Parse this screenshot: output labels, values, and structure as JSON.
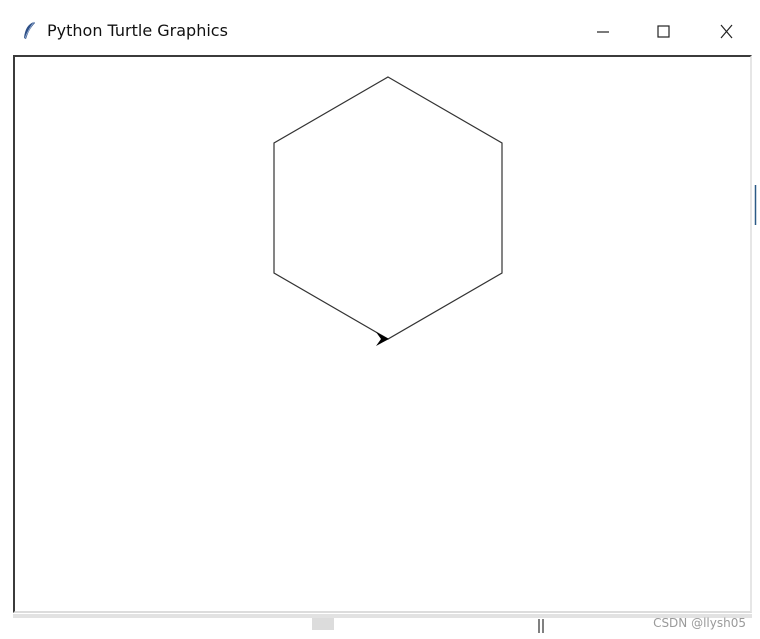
{
  "window": {
    "title": "Python Turtle Graphics",
    "app_icon": "tk-feather-icon",
    "controls": {
      "minimize": "minimize-icon",
      "maximize": "maximize-icon",
      "close": "close-icon"
    }
  },
  "canvas": {
    "background": "#ffffff",
    "drawing": {
      "shape": "hexagon",
      "stroke_color": "#333333",
      "turtle_cursor": "turtle-arrow-icon",
      "turtle_heading": "east"
    }
  },
  "watermark": {
    "text": "CSDN @llysh05"
  }
}
